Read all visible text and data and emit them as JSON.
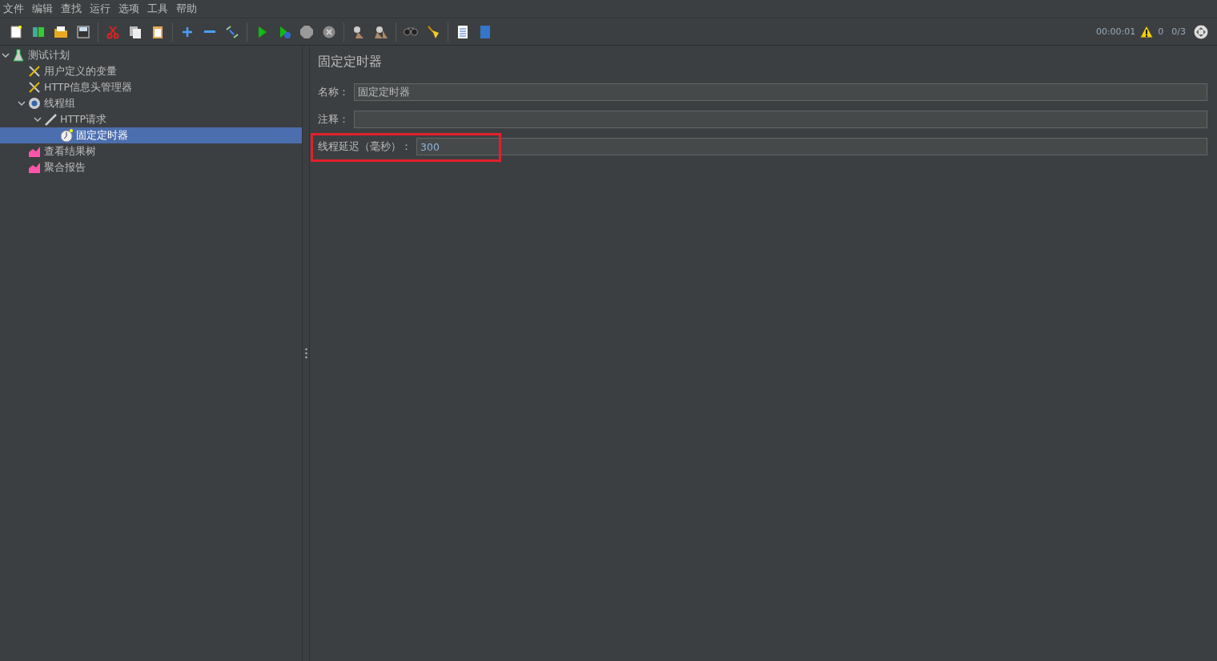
{
  "menu": [
    "文件",
    "编辑",
    "查找",
    "运行",
    "选项",
    "工具",
    "帮助"
  ],
  "status": {
    "timer": "00:00:01",
    "warnings": "0",
    "threads": "0/3"
  },
  "tree": [
    {
      "label": "测试计划",
      "kind": "plan",
      "expanded": true,
      "selected": false,
      "children": [
        {
          "label": "用户定义的变量",
          "kind": "config",
          "selected": false
        },
        {
          "label": "HTTP信息头管理器",
          "kind": "config",
          "selected": false
        },
        {
          "label": "线程组",
          "kind": "threads",
          "expanded": true,
          "selected": false,
          "children": [
            {
              "label": "HTTP请求",
              "kind": "sampler",
              "expanded": true,
              "selected": false,
              "children": [
                {
                  "label": "固定定时器",
                  "kind": "timer",
                  "selected": true
                }
              ]
            }
          ]
        },
        {
          "label": "查看结果树",
          "kind": "listener",
          "selected": false
        },
        {
          "label": "聚合报告",
          "kind": "listener",
          "selected": false
        }
      ]
    }
  ],
  "panel": {
    "title": "固定定时器",
    "fields": [
      {
        "label": "名称：",
        "value": "固定定时器",
        "highlighted": false
      },
      {
        "label": "注释：",
        "highlighted": false
      },
      {
        "label": "线程延迟（毫秒）：",
        "value": "300",
        "highlighted": true
      }
    ]
  }
}
